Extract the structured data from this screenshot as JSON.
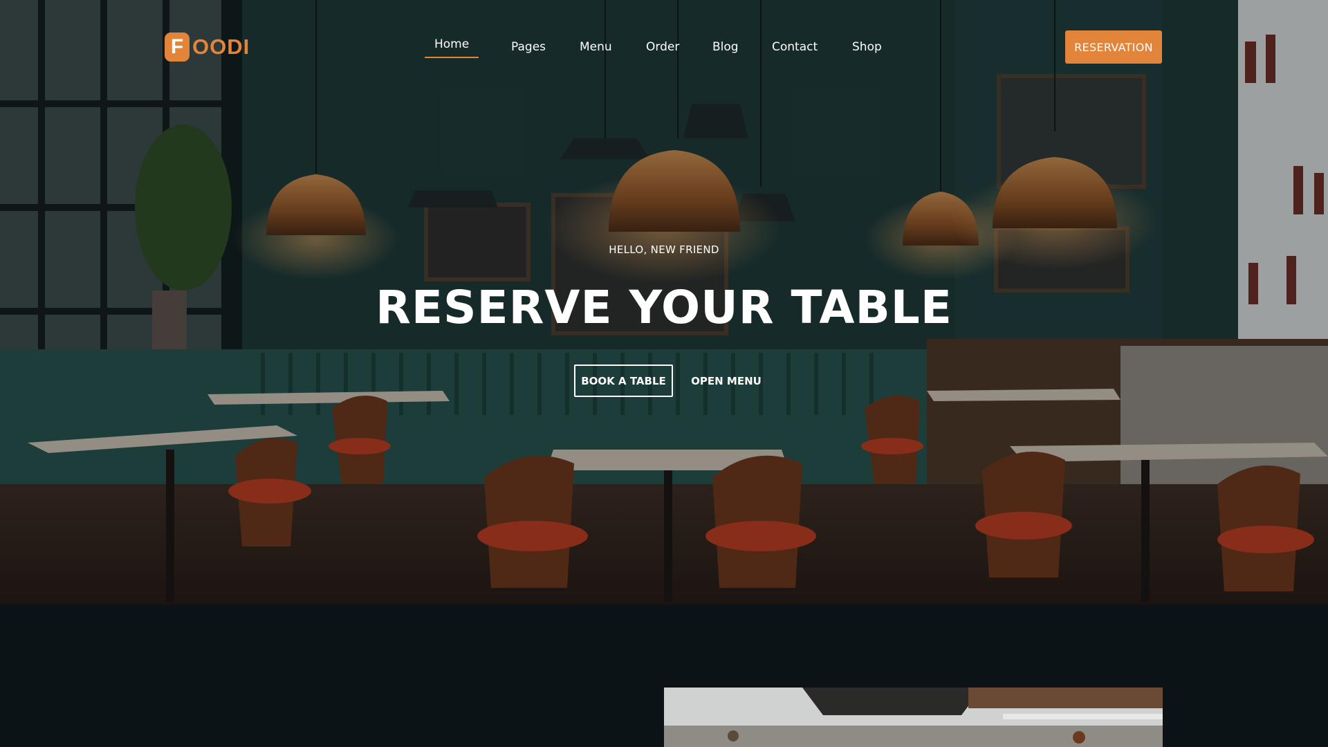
{
  "brand": {
    "badge_letter": "F",
    "wordmark": "OODI",
    "accent_color": "#e2843a"
  },
  "nav": {
    "items": [
      {
        "label": "Home",
        "active": true
      },
      {
        "label": "Pages",
        "active": false
      },
      {
        "label": "Menu",
        "active": false
      },
      {
        "label": "Order",
        "active": false
      },
      {
        "label": "Blog",
        "active": false
      },
      {
        "label": "Contact",
        "active": false
      },
      {
        "label": "Shop",
        "active": false
      }
    ],
    "reservation_label": "RESERVATION"
  },
  "hero": {
    "subtitle": "HELLO, NEW FRIEND",
    "title": "RESERVE YOUR TABLE",
    "primary_cta": "BOOK A TABLE",
    "secondary_cta": "OPEN MENU",
    "background": "restaurant-interior-photo"
  },
  "section2": {
    "image": "kitchen-photo"
  },
  "colors": {
    "page_background": "#0b1317",
    "text": "#ffffff"
  }
}
